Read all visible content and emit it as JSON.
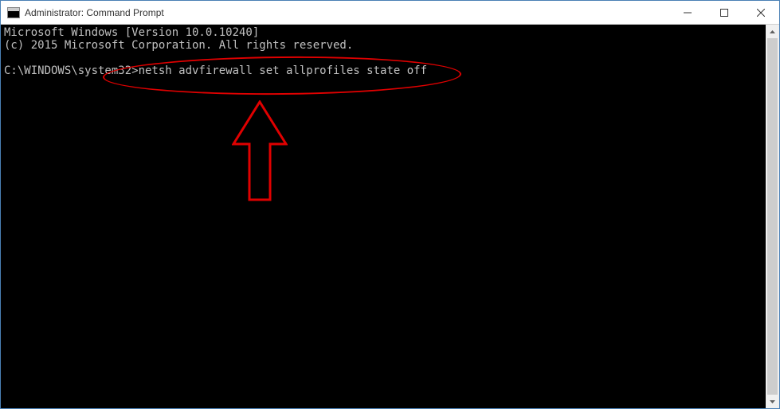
{
  "window": {
    "title": "Administrator: Command Prompt"
  },
  "console": {
    "line1": "Microsoft Windows [Version 10.0.10240]",
    "line2": "(c) 2015 Microsoft Corporation. All rights reserved.",
    "blank": "",
    "prompt": "C:\\WINDOWS\\system32>",
    "command": "netsh advfirewall set allprofiles state off"
  },
  "annotation": {
    "color": "#e00000"
  }
}
